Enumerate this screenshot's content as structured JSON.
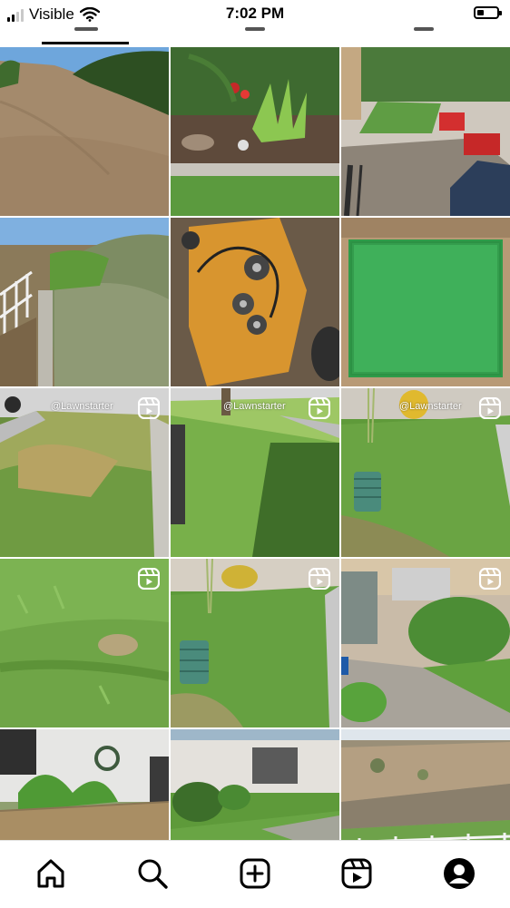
{
  "status_bar": {
    "carrier": "Visible",
    "time": "7:02 PM",
    "battery_level": 0.35,
    "signal_bars": 2,
    "icons": [
      "signal-icon",
      "wifi-icon",
      "battery-icon"
    ]
  },
  "profile_tabs": {
    "active_tab": 0,
    "icons": [
      "grid-icon",
      "reels-tab-icon",
      "tagged-icon"
    ]
  },
  "grid": {
    "posts": [
      {
        "kind": "photo",
        "subject": "dry hillside lawn"
      },
      {
        "kind": "photo",
        "subject": "garden bed with plants"
      },
      {
        "kind": "photo",
        "subject": "patio with red chairs"
      },
      {
        "kind": "photo",
        "subject": "roadside shrubs"
      },
      {
        "kind": "photo",
        "subject": "mower deck"
      },
      {
        "kind": "photo",
        "subject": "green turf sample"
      },
      {
        "kind": "reel",
        "subject": "patchy front lawn",
        "watermark": "@Lawnstarter"
      },
      {
        "kind": "reel",
        "subject": "green front lawn",
        "watermark": "@Lawnstarter"
      },
      {
        "kind": "reel",
        "subject": "lawn with green box",
        "watermark": "@Lawnstarter"
      },
      {
        "kind": "reel",
        "subject": "close lawn"
      },
      {
        "kind": "reel",
        "subject": "lawn with hedge"
      },
      {
        "kind": "reel",
        "subject": "walkway with bushes"
      },
      {
        "kind": "photo",
        "subject": "plants by wall with hose"
      },
      {
        "kind": "photo",
        "subject": "house front lawn"
      },
      {
        "kind": "photo",
        "subject": "fenced field"
      }
    ]
  },
  "bottom_nav": {
    "items": [
      {
        "name": "home",
        "icon": "home-icon"
      },
      {
        "name": "search",
        "icon": "search-icon"
      },
      {
        "name": "create",
        "icon": "new-post-icon"
      },
      {
        "name": "reels",
        "icon": "reels-icon"
      },
      {
        "name": "profile",
        "icon": "profile-icon"
      }
    ]
  }
}
